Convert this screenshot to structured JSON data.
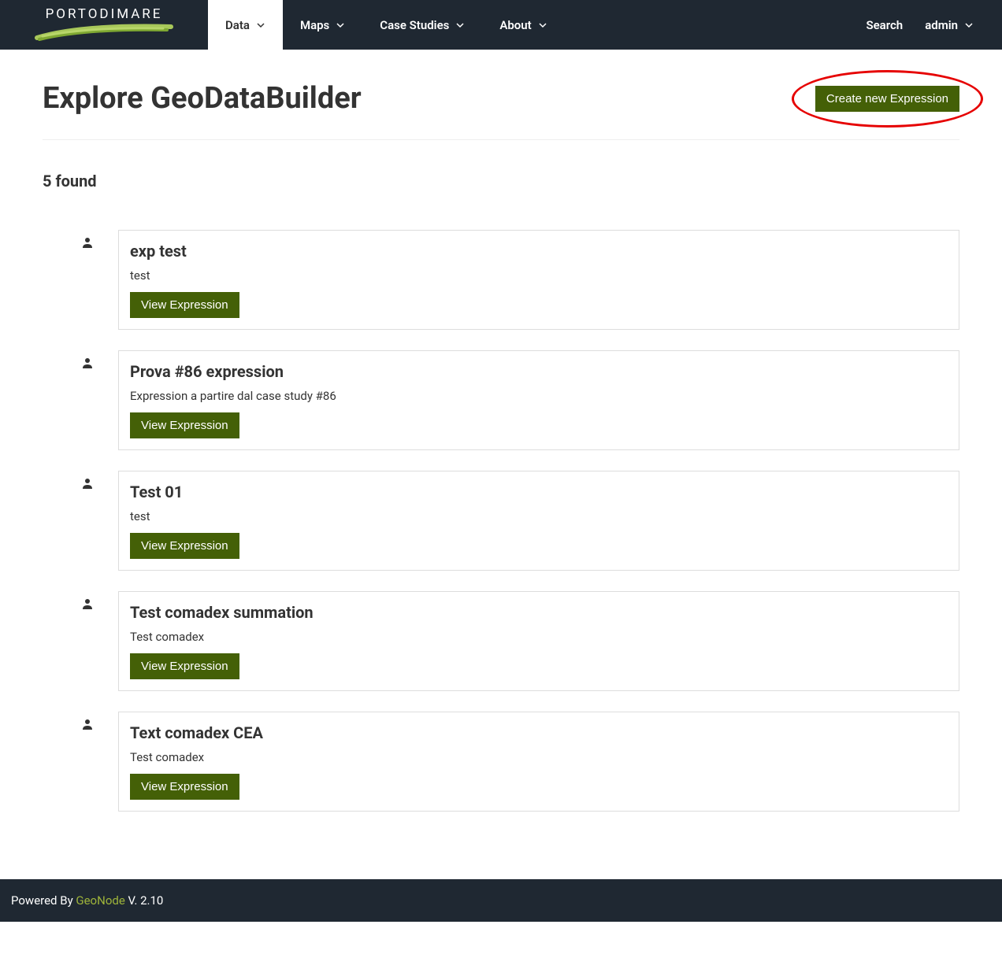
{
  "logo": {
    "text": "PORTODIMARE"
  },
  "nav": {
    "items": [
      {
        "label": "Data"
      },
      {
        "label": "Maps"
      },
      {
        "label": "Case Studies"
      },
      {
        "label": "About"
      }
    ],
    "search": "Search",
    "user": "admin"
  },
  "page": {
    "title": "Explore GeoDataBuilder",
    "create_button": "Create new Expression",
    "count_found": "5 found"
  },
  "expressions": [
    {
      "title": "exp test",
      "description": "test",
      "button": "View Expression"
    },
    {
      "title": "Prova #86 expression",
      "description": "Expression a partire dal case study #86",
      "button": "View Expression"
    },
    {
      "title": "Test 01",
      "description": "test",
      "button": "View Expression"
    },
    {
      "title": "Test comadex summation",
      "description": "Test comadex",
      "button": "View Expression"
    },
    {
      "title": "Text comadex CEA",
      "description": "Test comadex",
      "button": "View Expression"
    }
  ],
  "footer": {
    "powered_by": "Powered By ",
    "geonode": "GeoNode",
    "version": " V. 2.10"
  },
  "colors": {
    "navbar_bg": "#1f2832",
    "button_green": "#446007",
    "highlight_red": "#e60000",
    "link_green": "#9fb53a"
  }
}
